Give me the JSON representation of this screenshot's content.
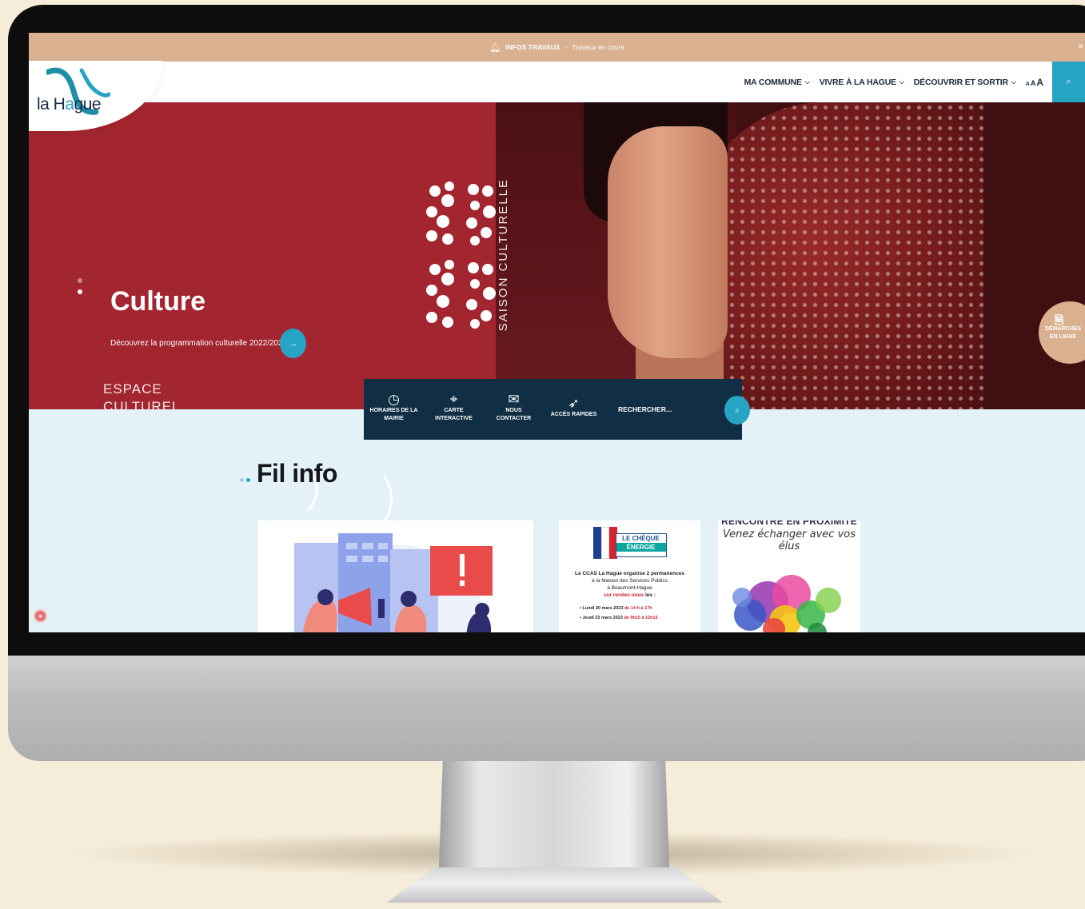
{
  "alert": {
    "label": "INFOS TRAVAUX",
    "separator": "-",
    "message": "Travaux en cours",
    "close": "×",
    "bell_icon": "bell-icon"
  },
  "logo": {
    "text": "la Hague",
    "text_left": "la H",
    "text_right": "gue"
  },
  "nav": {
    "items": [
      {
        "label": "MA COMMUNE"
      },
      {
        "label": "VIVRE À LA HAGUE"
      },
      {
        "label": "DÉCOUVRIR ET SORTIR"
      }
    ],
    "font_size_labels": [
      "A",
      "A",
      "A"
    ],
    "search_icon": "search-icon"
  },
  "hero": {
    "title": "Culture",
    "subtitle": "Découvrez la programmation culturelle 2022/2023",
    "season_label": "SAISON CULTURELLE",
    "caption_line1": "ESPACE",
    "caption_line2": "CULTUREL",
    "arrow": "→"
  },
  "demarches": {
    "line1": "DÉMARCHES",
    "line2": "EN LIGNE"
  },
  "quick_links": [
    {
      "icon": "clock-icon",
      "glyph": "◷",
      "line1": "HORAIRES DE LA",
      "line2": "MAIRIE"
    },
    {
      "icon": "map-icon",
      "glyph": "⌖",
      "line1": "CARTE",
      "line2": "INTERACTIVE"
    },
    {
      "icon": "envelope-icon",
      "glyph": "✉",
      "line1": "NOUS",
      "line2": "CONTACTER"
    },
    {
      "icon": "rocket-icon",
      "glyph": "➶",
      "line1": "ACCÈS RAPIDES",
      "line2": ""
    }
  ],
  "search": {
    "placeholder": "RECHERCHER..."
  },
  "fil_info": {
    "title": "Fil info"
  },
  "cards": {
    "cheque": {
      "logo_top": "LE CHÈQUE",
      "logo_bottom": "ÉNERGIE",
      "line1": "Le CCAS La Hague organise 2 permanences",
      "line2": "à la Maison des Services Publics",
      "line3": "à Beaumont-Hague",
      "rdv_red": "sur rendez-vous",
      "rdv_black": "les :",
      "date1": "• Lundi 20 mars 2023",
      "time1": "de 14 h à 17h",
      "date2": "• Jeudi 23 mars 2023",
      "time2": "de 9h15 à 12h15"
    },
    "rencontre": {
      "title": "RENCONTRE EN PROXIMITÉ",
      "subtitle": "Venez échanger avec vos élus"
    }
  },
  "colors": {
    "accent": "#27a3c4",
    "hero_red": "#a3252f",
    "alert_bar": "#dab190",
    "quick_bar": "#102f44",
    "section_bg": "#e4f2f8"
  }
}
